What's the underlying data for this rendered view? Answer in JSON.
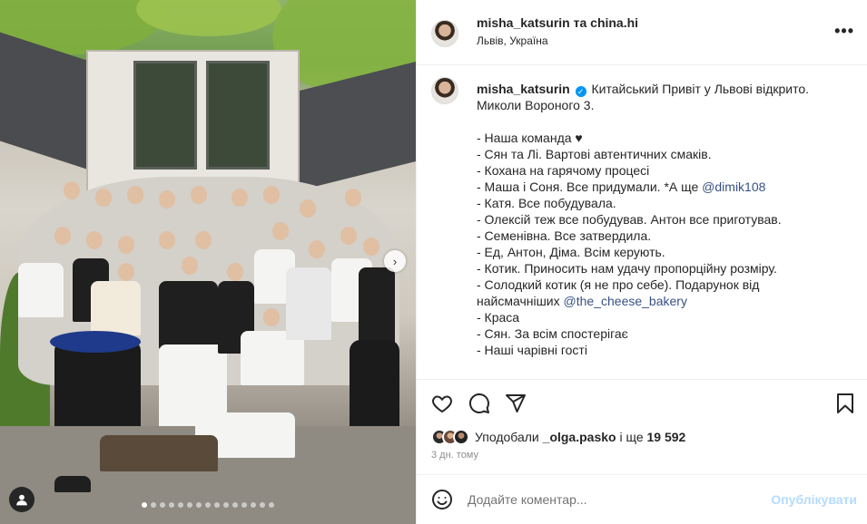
{
  "header": {
    "username": "misha_katsurin",
    "and_text": "та",
    "collab_username": "china.hi",
    "location": "Львів, Україна",
    "more_icon": "more-horizontal-icon"
  },
  "caption": {
    "username": "misha_katsurin",
    "verified": "✓",
    "lines": [
      "Китайський Привіт у Львові відкрито.",
      "Миколи Вороного 3.",
      "",
      "- Наша команда ♥",
      "- Сян та Лі. Вартові автентичних смаків.",
      "- Кохана на гарячому процесі",
      "- Маша і Соня. Все придумали. *А ще",
      "- Катя. Все побудувала.",
      "- Олексій теж все побудував. Антон все приготував.",
      "- Семенівна. Все затвердила.",
      "- Ед, Антон, Діма. Всім керують.",
      "- Котик. Приносить нам удачу пропорційну розміру.",
      "- Солодкий котик (я не про себе). Подарунок від",
      "найсмачніших",
      "- Краса",
      "- Сян. За всім спостерігає",
      "- Наші чарівні гості"
    ],
    "mention_dimik": "@dimik108",
    "mention_bakery": "@the_cheese_bakery"
  },
  "actions": {
    "like_icon": "heart-icon",
    "comment_icon": "comment-icon",
    "share_icon": "share-icon",
    "save_icon": "bookmark-icon"
  },
  "likes": {
    "prefix": "Уподобали",
    "liker": "_olga.pasko",
    "joiner": "і ще",
    "count": "19 592"
  },
  "post_time": "3 дн. тому",
  "comment": {
    "placeholder": "Додайте коментар...",
    "publish_label": "Опублікувати"
  },
  "carousel": {
    "total_slides": 15,
    "active_index": 0
  },
  "colors": {
    "accent": "#0095f6",
    "publish_disabled": "#b3dbff",
    "mention": "#385185"
  }
}
